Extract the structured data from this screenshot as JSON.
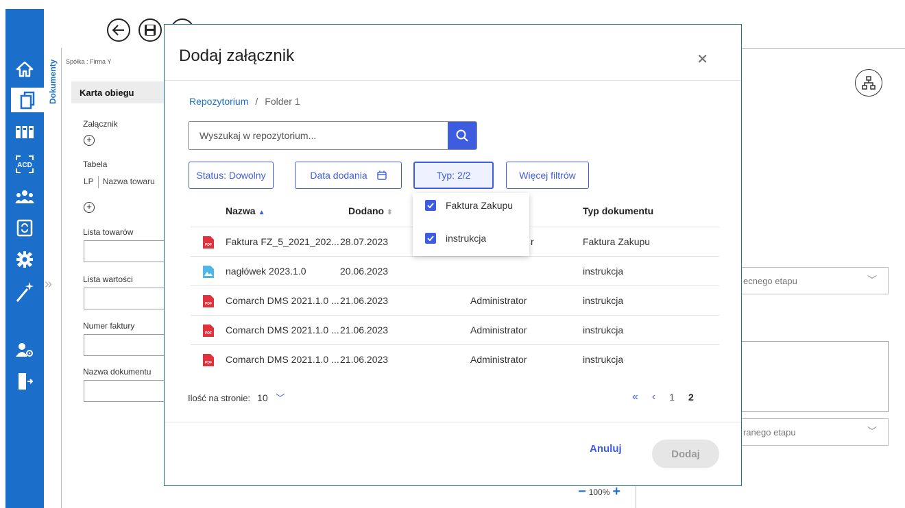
{
  "toolbar": {
    "back_icon": "arrow-left-circle-icon",
    "save_icon": "floppy-disk-icon"
  },
  "sidebar": {
    "items": [
      {
        "icon": "home-icon"
      },
      {
        "icon": "documents-icon",
        "active": true
      },
      {
        "icon": "binders-icon"
      },
      {
        "icon": "acd-icon"
      },
      {
        "icon": "users-icon"
      },
      {
        "icon": "document-sync-icon"
      },
      {
        "icon": "gear-icon"
      },
      {
        "icon": "magic-wand-icon"
      },
      {
        "icon": "user-settings-icon"
      },
      {
        "icon": "logout-icon"
      }
    ],
    "accent": "#1b6fca",
    "dokumenty_tab": "Dokumenty"
  },
  "background": {
    "company": "Spółka : Firma Y",
    "card_title": "Karta obiegu",
    "attachment_label": "Załącznik",
    "table_label": "Tabela",
    "table_col_lp": "LP",
    "table_col_name": "Nazwa towaru",
    "goods_list": "Lista towarów",
    "values_list": "Lista wartości",
    "invoice_number": "Numer faktury",
    "document_name": "Nazwa dokumentu",
    "select_current_stage": "ecnego etapu",
    "select_chosen_stage": "ranego etapu",
    "zoom_level": "100%"
  },
  "modal": {
    "title": "Dodaj załącznik",
    "breadcrumb": {
      "root": "Repozytorium",
      "separator": "/",
      "current": "Folder 1"
    },
    "search": {
      "placeholder": "Wyszukaj w repozytorium..."
    },
    "filters": {
      "status": "Status: Dowolny",
      "date": "Data dodania",
      "type": "Typ: 2/2",
      "more": "Więcej filtrów"
    },
    "type_dropdown": [
      {
        "label": "Faktura Zakupu",
        "checked": true
      },
      {
        "label": "instrukcja",
        "checked": true
      }
    ],
    "columns": {
      "name": "Nazwa",
      "added": "Dodano",
      "doc_type": "Typ dokumentu"
    },
    "rows": [
      {
        "icon": "pdf-icon",
        "name": "Faktura FZ_5_2021_202...",
        "added": "28.07.2023",
        "author": "r",
        "type": "Faktura Zakupu"
      },
      {
        "icon": "image-icon",
        "name": "nagłówek 2023.1.0",
        "added": "20.06.2023",
        "author": "",
        "type": "instrukcja"
      },
      {
        "icon": "pdf-icon",
        "name": "Comarch DMS 2021.1.0 ...",
        "added": "21.06.2023",
        "author": "Administrator",
        "type": "instrukcja"
      },
      {
        "icon": "pdf-icon",
        "name": "Comarch DMS 2021.1.0 ...",
        "added": "21.06.2023",
        "author": "Administrator",
        "type": "instrukcja"
      },
      {
        "icon": "pdf-icon",
        "name": "Comarch DMS 2021.1.0 ...",
        "added": "21.06.2023",
        "author": "Administrator",
        "type": "instrukcja"
      }
    ],
    "pager": {
      "per_page_label": "Ilość na stronie:",
      "per_page_value": "10",
      "pages": [
        "1",
        "2"
      ],
      "current_page": "2"
    },
    "actions": {
      "cancel": "Anuluj",
      "add": "Dodaj"
    }
  }
}
